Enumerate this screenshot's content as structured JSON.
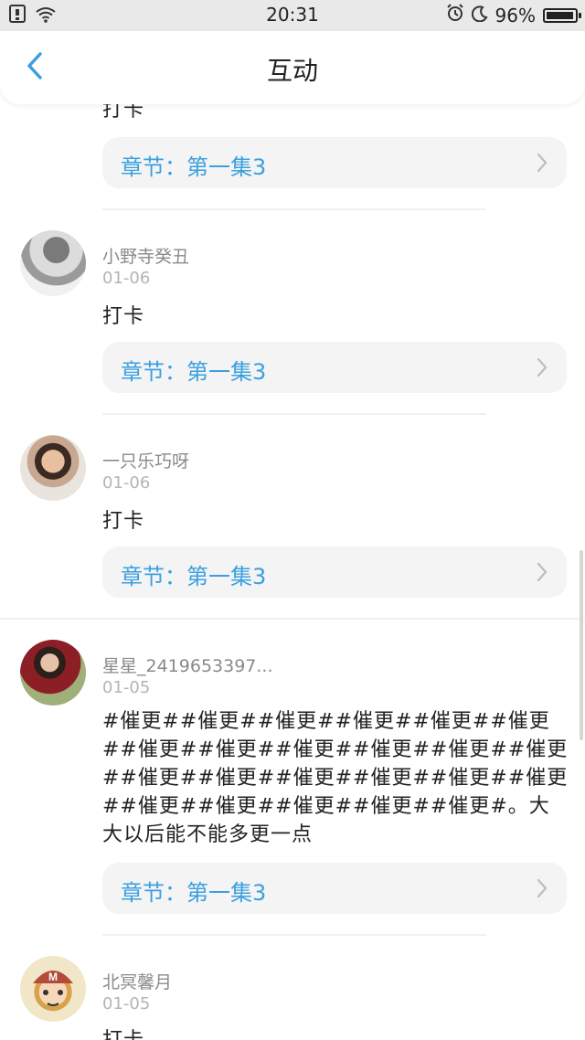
{
  "status_bar": {
    "time": "20:31",
    "battery_percent": "96%",
    "battery_level": 0.96
  },
  "header": {
    "title": "互动"
  },
  "top_partial": {
    "comment": "打卡",
    "chapter_label": "章节：第一集3"
  },
  "comments": [
    {
      "username": "小野寺癸丑",
      "date": "01-06",
      "text": "打卡",
      "chapter_label": "章节：第一集3"
    },
    {
      "username": "一只乐巧呀",
      "date": "01-06",
      "text": "打卡",
      "chapter_label": "章节：第一集3"
    },
    {
      "username": "星星_2419653397...",
      "date": "01-05",
      "text": "#催更##催更##催更##催更##催更##催更##催更##催更##催更##催更##催更##催更##催更##催更##催更##催更##催更##催更##催更##催更##催更##催更##催更#。大大以后能不能多更一点",
      "chapter_label": "章节：第一集3"
    },
    {
      "username": "北冥馨月",
      "date": "01-05",
      "text": "打卡"
    }
  ],
  "colors": {
    "accent": "#3aa0e0",
    "status_bar_bg": "#e9e9e9",
    "card_bg": "#f4f4f4"
  }
}
